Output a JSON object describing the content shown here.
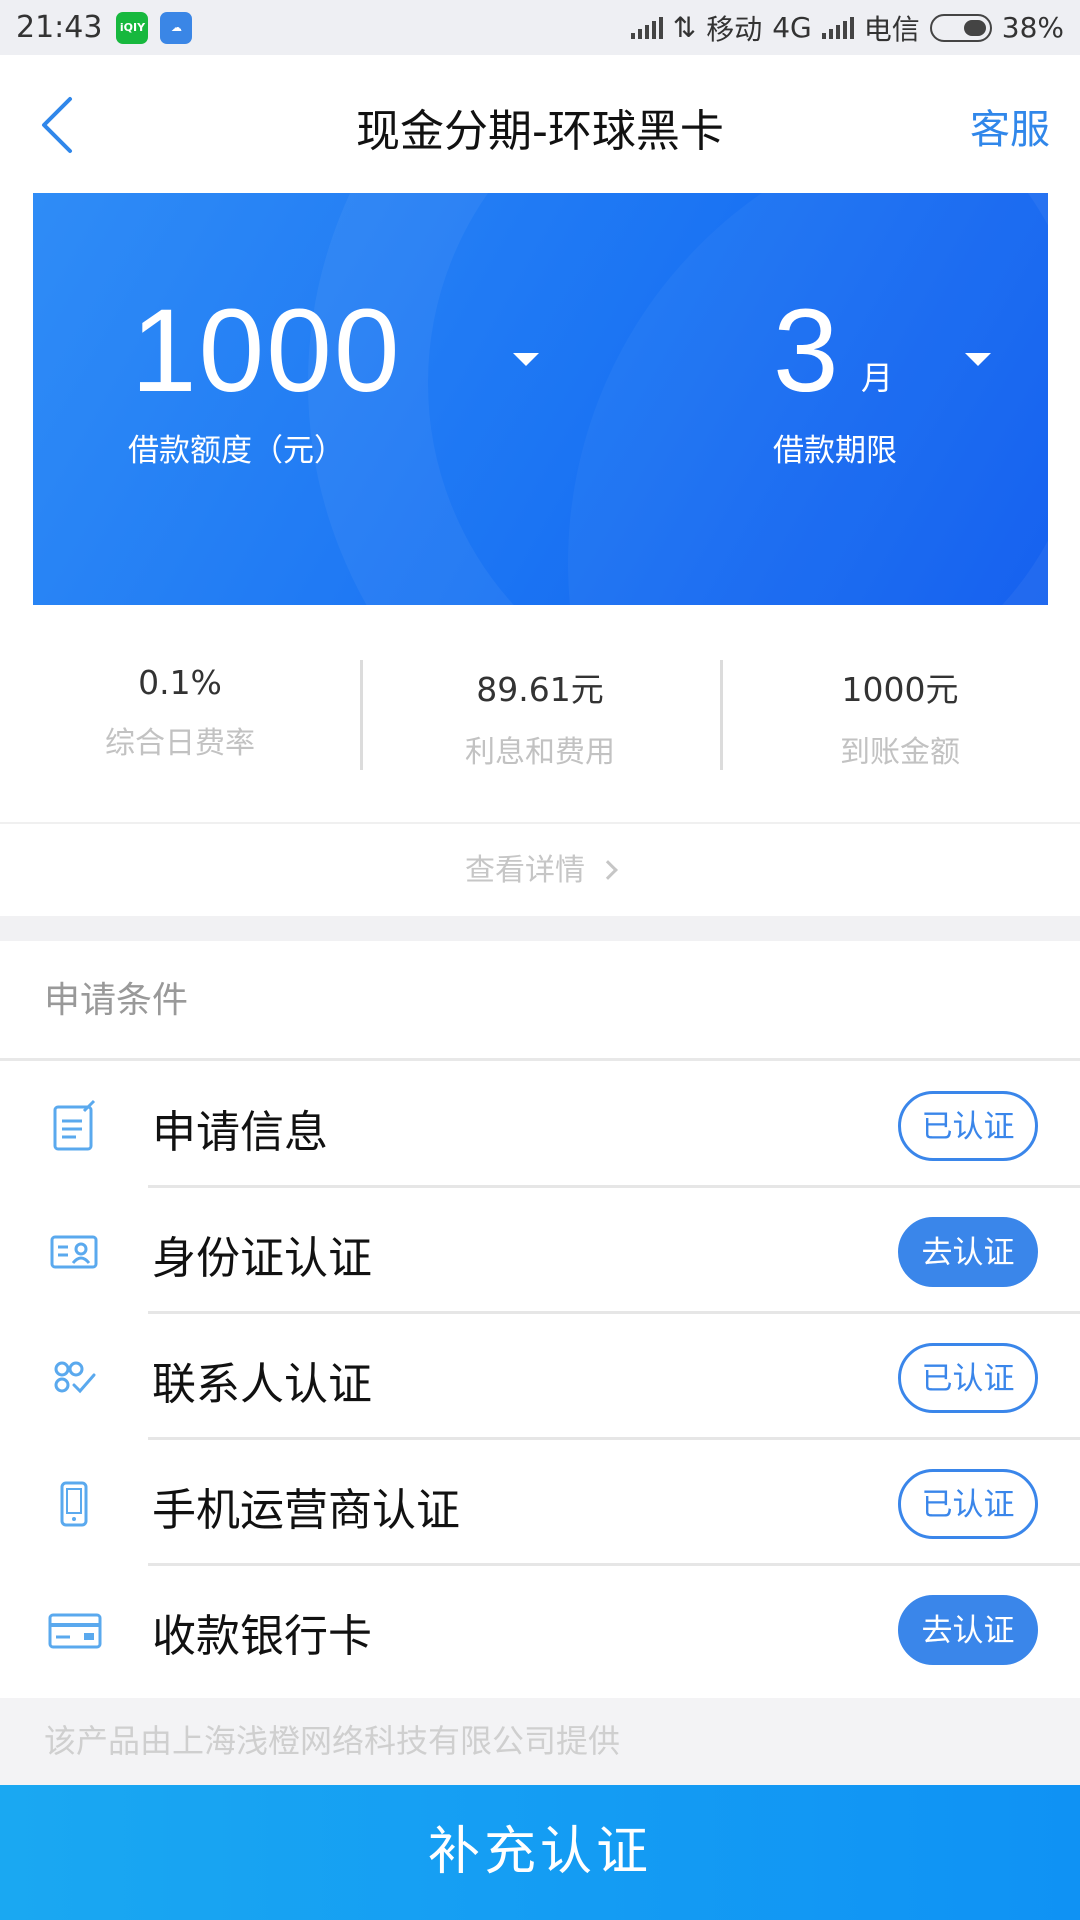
{
  "status_bar": {
    "time": "21:43",
    "carrier1": "移动",
    "network": "4G",
    "carrier2": "电信",
    "battery": "38%",
    "apps": [
      "iqiyi-icon",
      "cloud-icon"
    ]
  },
  "header": {
    "title": "现金分期-环球黑卡",
    "service": "客服"
  },
  "loan": {
    "amount": "1000",
    "amount_label": "借款额度（元）",
    "term": "3",
    "term_unit": "月",
    "term_label": "借款期限"
  },
  "stats": [
    {
      "value": "0.1%",
      "label": "综合日费率"
    },
    {
      "value": "89.61元",
      "label": "利息和费用"
    },
    {
      "value": "1000元",
      "label": "到账金额"
    }
  ],
  "details_link": "查看详情",
  "conditions": {
    "title": "申请条件",
    "items": [
      {
        "label": "申请信息",
        "status": "已认证",
        "icon": "document-icon"
      },
      {
        "label": "身份证认证",
        "status": "去认证",
        "icon": "id-card-icon"
      },
      {
        "label": "联系人认证",
        "status": "已认证",
        "icon": "contacts-icon"
      },
      {
        "label": "手机运营商认证",
        "status": "已认证",
        "icon": "phone-icon"
      },
      {
        "label": "收款银行卡",
        "status": "去认证",
        "icon": "bank-card-icon"
      }
    ]
  },
  "provider_note": "该产品由上海浅橙网络科技有限公司提供",
  "submit_label": "补充认证",
  "colors": {
    "accent": "#3a86ea",
    "card_blue": "#1b74f3",
    "submit": "#14a0f3"
  }
}
